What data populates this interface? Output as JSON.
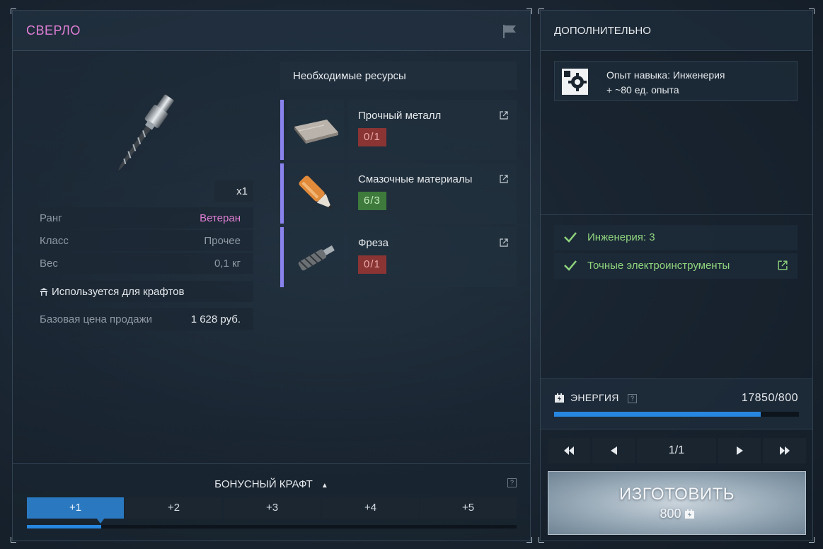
{
  "item": {
    "title": "СВЕРЛО",
    "quantity": "x1",
    "stats": [
      {
        "label": "Ранг",
        "value": "Ветеран",
        "color": "#e07fd5"
      },
      {
        "label": "Класс",
        "value": "Прочее"
      },
      {
        "label": "Вес",
        "value": "0,1 кг"
      }
    ],
    "uses_label": "Используется для крафтов",
    "price_label": "Базовая цена продажи",
    "price_value": "1 628 руб."
  },
  "resources": {
    "header": "Необходимые ресурсы",
    "items": [
      {
        "name": "Прочный металл",
        "count": "0/1",
        "status": "missing",
        "icon": "metal-sheet-icon"
      },
      {
        "name": "Смазочные материалы",
        "count": "6/3",
        "status": "ok",
        "icon": "lubricant-icon"
      },
      {
        "name": "Фреза",
        "count": "0/1",
        "status": "missing",
        "icon": "milling-cutter-icon"
      }
    ]
  },
  "bonus": {
    "title": "БОНУСНЫЙ КРАФТ",
    "help": "?",
    "tabs": [
      "+1",
      "+2",
      "+3",
      "+4",
      "+5"
    ],
    "active_index": 0
  },
  "side": {
    "title": "ДОПОЛНИТЕЛЬНО",
    "skill_line1": "Опыт навыка: Инженерия",
    "skill_line2": "+ ~80 ед. опыта",
    "requirements": [
      {
        "label": "Инженерия: 3",
        "met": true
      },
      {
        "label": "Точные электроинструменты",
        "met": true,
        "link": true
      }
    ]
  },
  "energy": {
    "label": "ЭНЕРГИЯ",
    "help": "?",
    "value": "17850/800",
    "bar_fraction": 0.845
  },
  "pager": {
    "page": "1/1",
    "first": "⏮",
    "prev": "◀",
    "next": "▶",
    "last": "⏭"
  },
  "craft": {
    "label": "ИЗГОТОВИТЬ",
    "cost": "800"
  },
  "colors": {
    "accent": "#2787e0",
    "rank": "#e07fd5",
    "ok": "#8fd47d",
    "missing_badge": "#8a3434",
    "ok_badge": "#3d7a3b",
    "resource_bar": "#8a83ee"
  }
}
